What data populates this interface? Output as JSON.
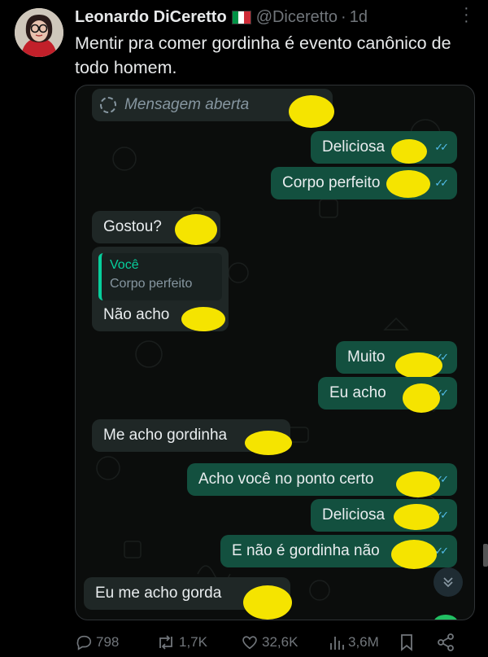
{
  "tweet": {
    "author_name": "Leonardo DiCeretto",
    "handle": "@Diceretto",
    "separator": "·",
    "time": "1d",
    "text": "Mentir pra comer gordinha é evento canônico de todo homem.",
    "flag_colors": [
      "#009246",
      "#ffffff",
      "#ce2b37"
    ]
  },
  "chat": {
    "system_message": "Mensagem aberta",
    "messages": [
      {
        "side": "out",
        "text": "Deliciosa"
      },
      {
        "side": "out",
        "text": "Corpo perfeito"
      },
      {
        "side": "in",
        "text": "Gostou?"
      },
      {
        "side": "in",
        "reply_author": "Você",
        "reply_text": "Corpo perfeito",
        "text": "Não acho"
      },
      {
        "side": "out",
        "text": "Muito"
      },
      {
        "side": "out",
        "text": "Eu acho"
      },
      {
        "side": "in",
        "text": "Me acho gordinha"
      },
      {
        "side": "out",
        "text": "Acho você no ponto certo"
      },
      {
        "side": "out",
        "text": "Deliciosa"
      },
      {
        "side": "out",
        "text": "E não é gordinha não"
      },
      {
        "side": "in",
        "text": "Eu me acho gorda"
      }
    ],
    "read_ticks": "✓✓",
    "scroll_down_icon": "chevron-double-down-icon",
    "colors": {
      "incoming": "#1f2726",
      "outgoing": "#13503f",
      "censor": "#f5e400",
      "ticks": "#53bdeb"
    }
  },
  "actions": {
    "replies": "798",
    "reposts": "1,7K",
    "likes": "32,6K",
    "views": "3,6M"
  }
}
